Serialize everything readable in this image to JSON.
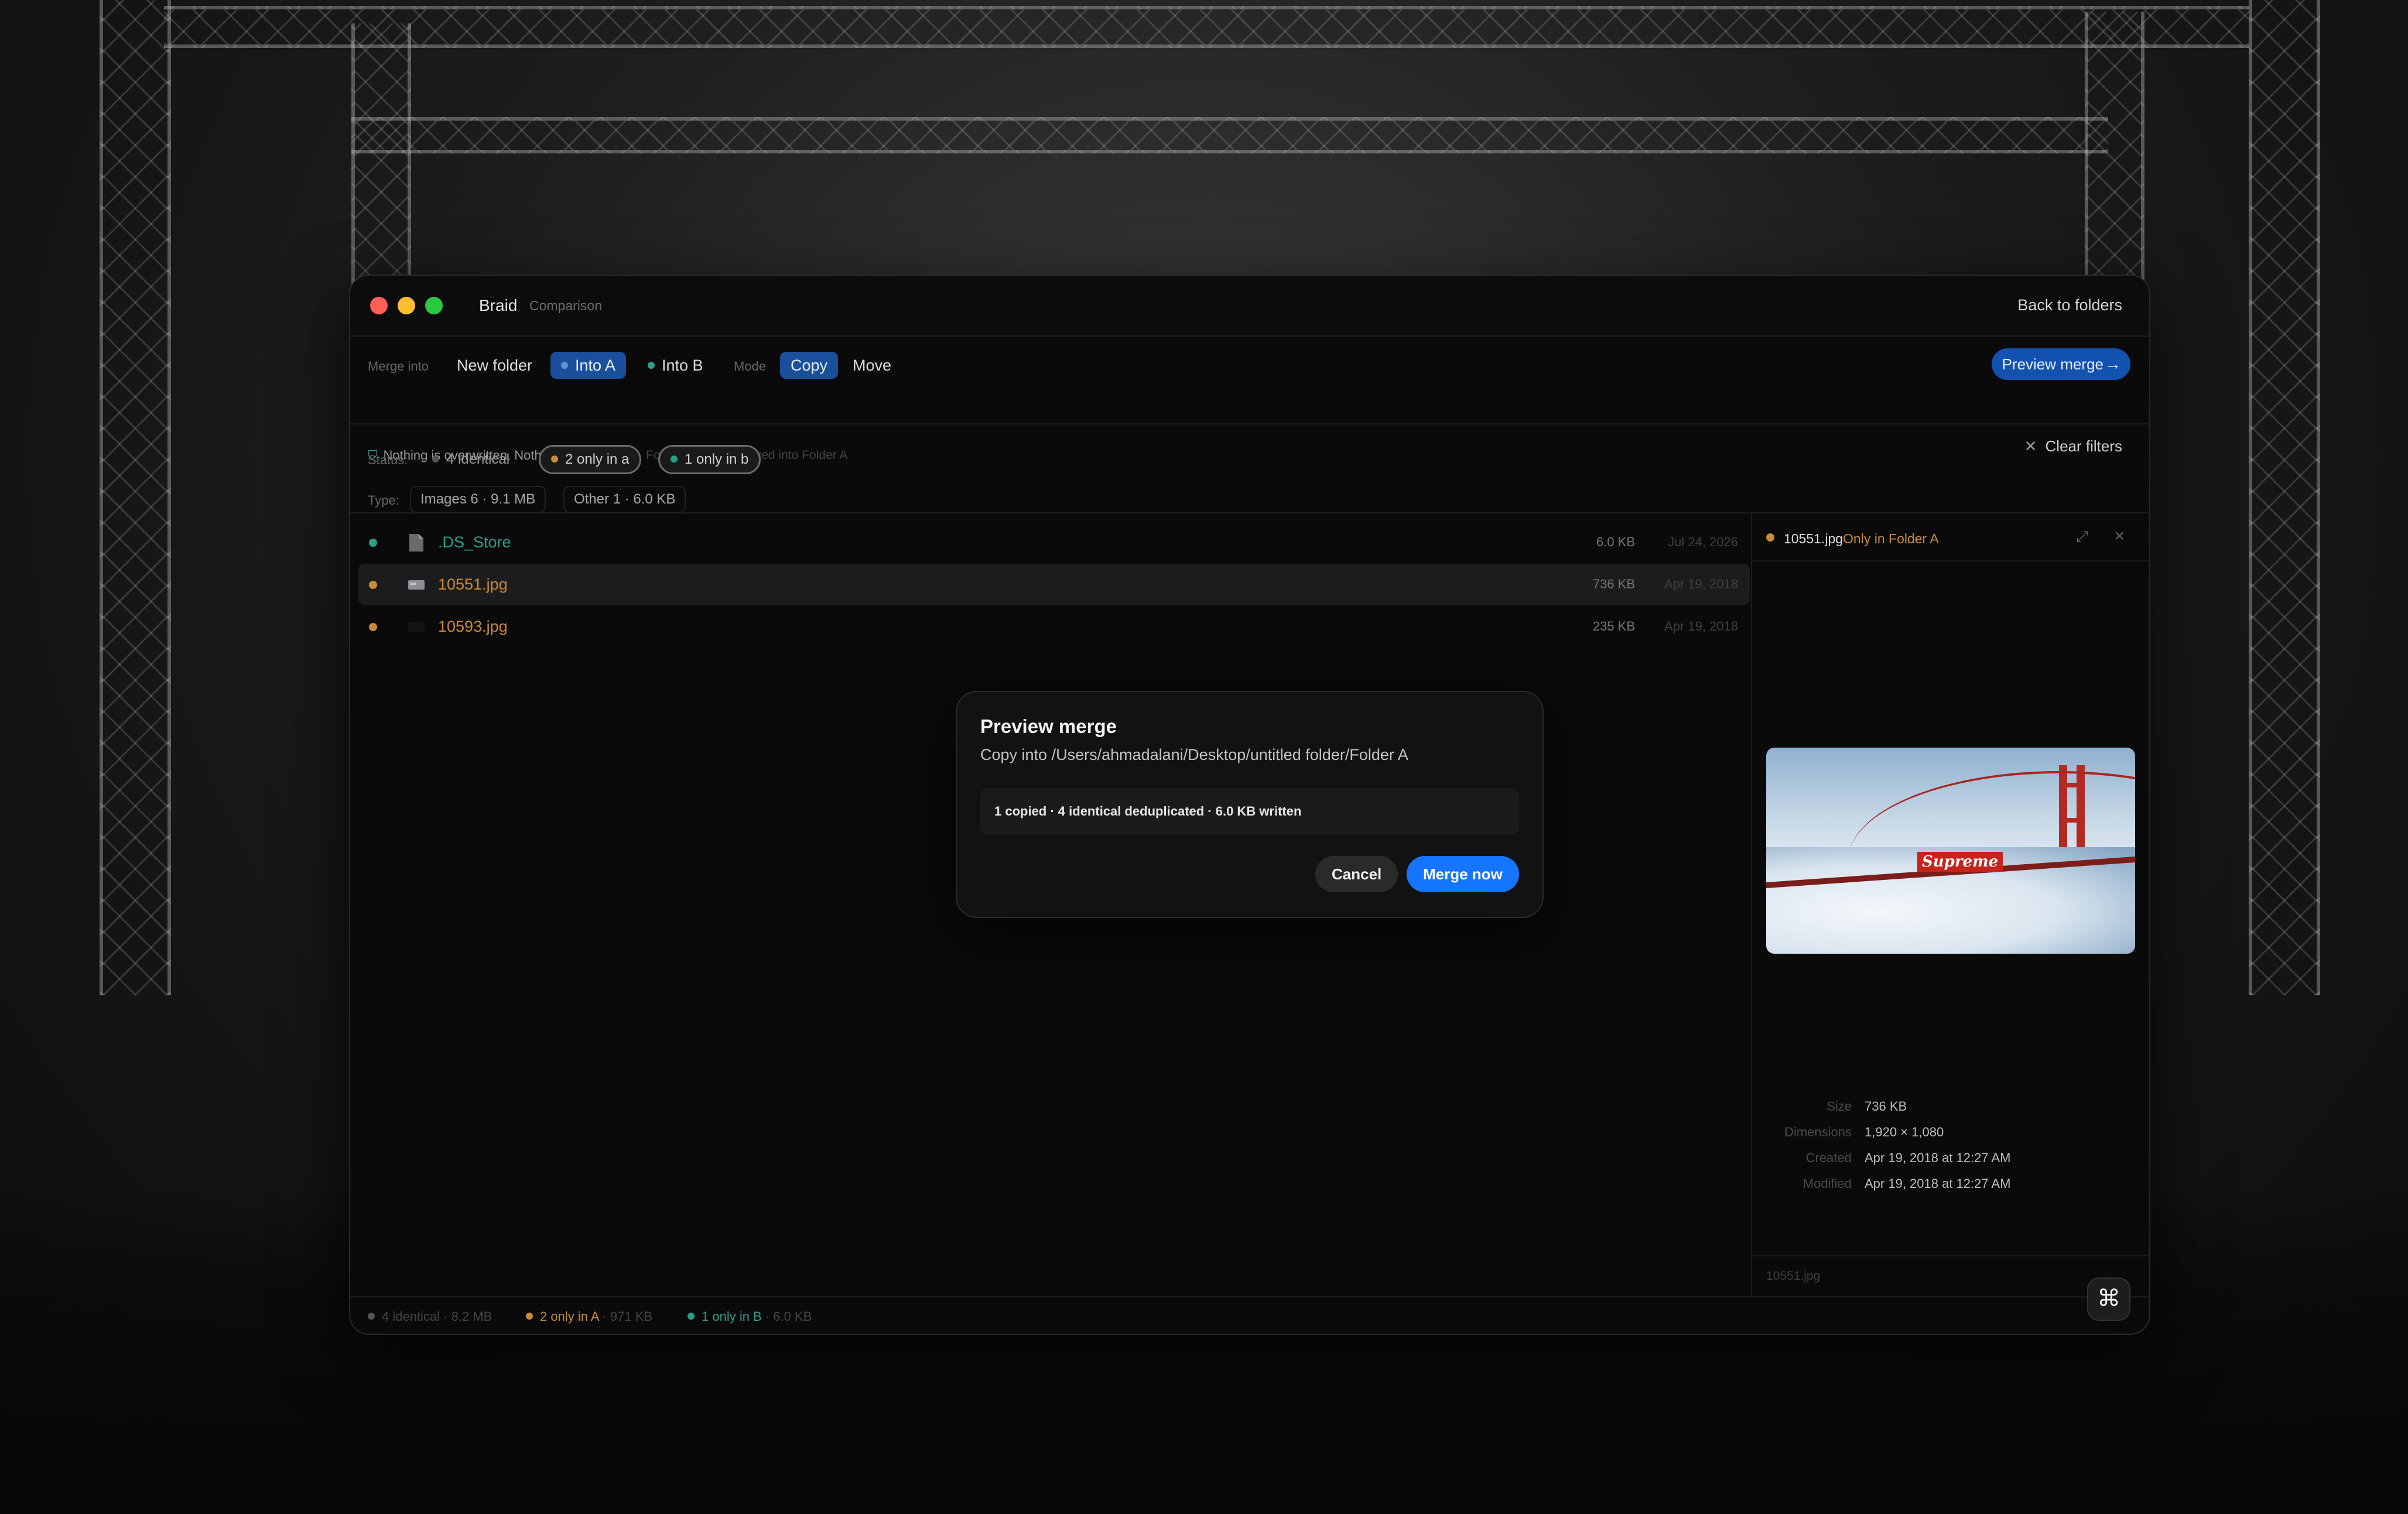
{
  "titlebar": {
    "app_name": "Braid",
    "view_name": "Comparison",
    "back_label": "Back to folders"
  },
  "toolbar": {
    "merge_into_label": "Merge into",
    "merge_targets": [
      {
        "label": "New folder",
        "selected": false
      },
      {
        "label": "Into A",
        "selected": true
      },
      {
        "label": "Into B",
        "selected": false
      }
    ],
    "mode_label": "Mode",
    "modes": [
      {
        "label": "Copy",
        "selected": true
      },
      {
        "label": "Move",
        "selected": false
      }
    ],
    "preview_button": "Preview merge",
    "notice": "Nothing is overwritten. Nothing is lost.",
    "notice_hint": "Folder B will be merged into Folder A"
  },
  "filters": {
    "status_label": "Status:",
    "status_chips": [
      {
        "label": "4 identical",
        "selected": false
      },
      {
        "label": "2 only in a",
        "selected": true
      },
      {
        "label": "1 only in b",
        "selected": true
      }
    ],
    "type_label": "Type:",
    "type_chips": [
      "Images 6 · 9.1 MB",
      "Other 1 · 6.0 KB"
    ],
    "clear_label": "Clear filters"
  },
  "files": [
    {
      "name": ".DS_Store",
      "size": "6.0 KB",
      "date": "Jul 24, 2026",
      "status": "only-in-b"
    },
    {
      "name": "10551.jpg",
      "size": "736 KB",
      "date": "Apr 19, 2018",
      "status": "only-in-a"
    },
    {
      "name": "10593.jpg",
      "size": "235 KB",
      "date": "Apr 19, 2018",
      "status": "only-in-a"
    }
  ],
  "detail": {
    "file_name": "10551.jpg",
    "file_status": "Only in Folder A",
    "image_logo_text": "Supreme",
    "meta": [
      {
        "key": "Size",
        "value": "736 KB"
      },
      {
        "key": "Dimensions",
        "value": "1,920 × 1,080"
      },
      {
        "key": "Created",
        "value": "Apr 19, 2018 at 12:27 AM"
      },
      {
        "key": "Modified",
        "value": "Apr 19, 2018 at 12:27 AM"
      }
    ],
    "footer_name": "10551.jpg"
  },
  "statusbar": {
    "identical": "4 identical",
    "identical_size": "· 8.2 MB",
    "only_a": "2 only in A",
    "only_a_size": "· 971 KB",
    "only_b": "1 only in B",
    "only_b_size": "· 6.0 KB"
  },
  "dialog": {
    "title": "Preview merge",
    "subtitle": "Copy into /Users/ahmadalani/Desktop/untitled folder/Folder A",
    "summary": "1 copied · 4 identical deduplicated · 6.0 KB written",
    "cancel": "Cancel",
    "confirm": "Merge now"
  },
  "colors": {
    "accent_blue": "#1575ff",
    "selected_segment": "#1a4f9c",
    "only_in_a": "#c98a3a",
    "only_in_b": "#2aa08b",
    "traffic_red": "#ff5f57",
    "traffic_yellow": "#febc2e",
    "traffic_green": "#28c840"
  }
}
